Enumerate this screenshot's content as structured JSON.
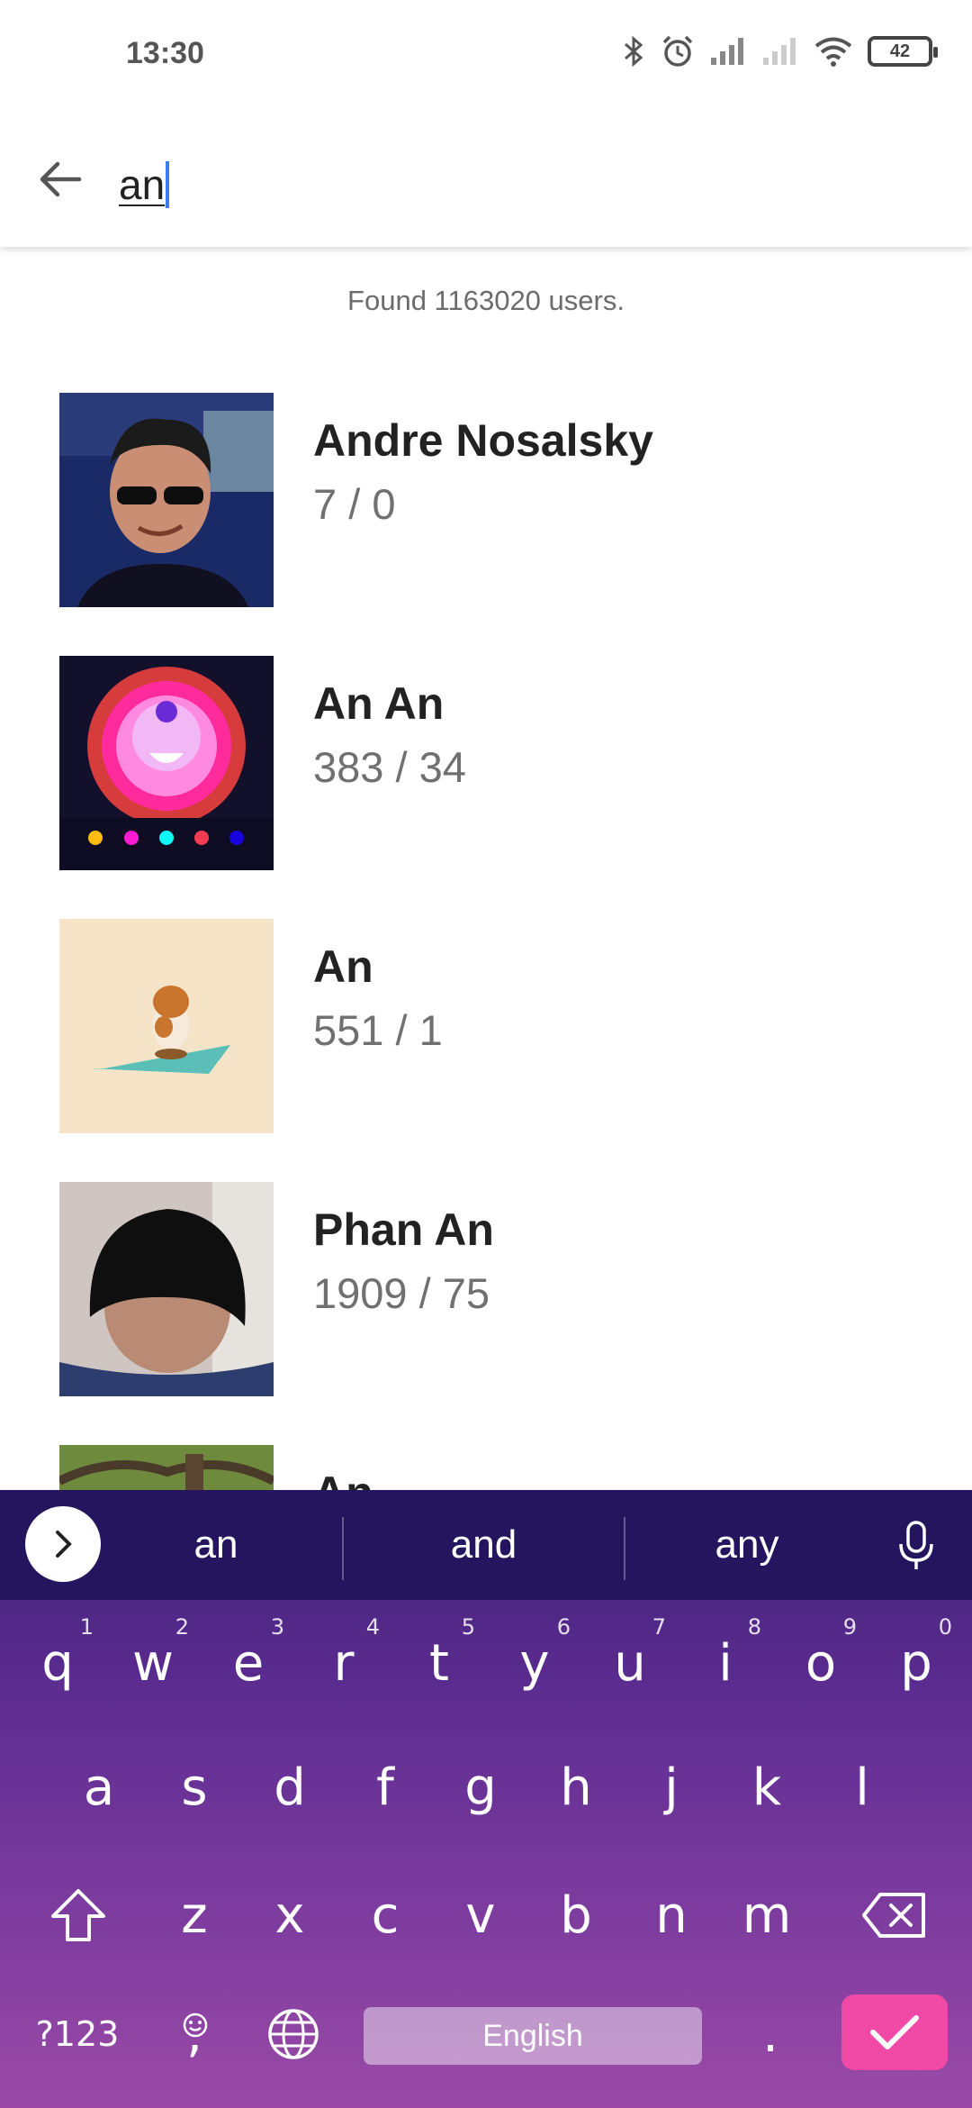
{
  "status": {
    "time": "13:30",
    "battery": "42",
    "icons": [
      "bluetooth-icon",
      "alarm-icon",
      "signal-icon",
      "signal-weak-icon",
      "wifi-icon",
      "battery-icon"
    ]
  },
  "search": {
    "query": "an"
  },
  "results": {
    "found_text": "Found 1163020 users.",
    "users": [
      {
        "name": "Andre Nosalsky",
        "stats": "7 / 0"
      },
      {
        "name": "An An",
        "stats": "383 / 34"
      },
      {
        "name": "An",
        "stats": "551 / 1"
      },
      {
        "name": "Phan An",
        "stats": "1909 / 75"
      },
      {
        "name": "An",
        "stats": ""
      }
    ]
  },
  "keyboard": {
    "suggestions": [
      "an",
      "and",
      "any"
    ],
    "row1": [
      {
        "key": "q",
        "hint": "1"
      },
      {
        "key": "w",
        "hint": "2"
      },
      {
        "key": "e",
        "hint": "3"
      },
      {
        "key": "r",
        "hint": "4"
      },
      {
        "key": "t",
        "hint": "5"
      },
      {
        "key": "y",
        "hint": "6"
      },
      {
        "key": "u",
        "hint": "7"
      },
      {
        "key": "i",
        "hint": "8"
      },
      {
        "key": "o",
        "hint": "9"
      },
      {
        "key": "p",
        "hint": "0"
      }
    ],
    "row2": [
      "a",
      "s",
      "d",
      "f",
      "g",
      "h",
      "j",
      "k",
      "l"
    ],
    "row3": [
      "z",
      "x",
      "c",
      "v",
      "b",
      "n",
      "m"
    ],
    "symbols_label": "?123",
    "comma_label": ",",
    "space_label": "English",
    "period_label": ".",
    "accent_color": "#f04aa6"
  }
}
